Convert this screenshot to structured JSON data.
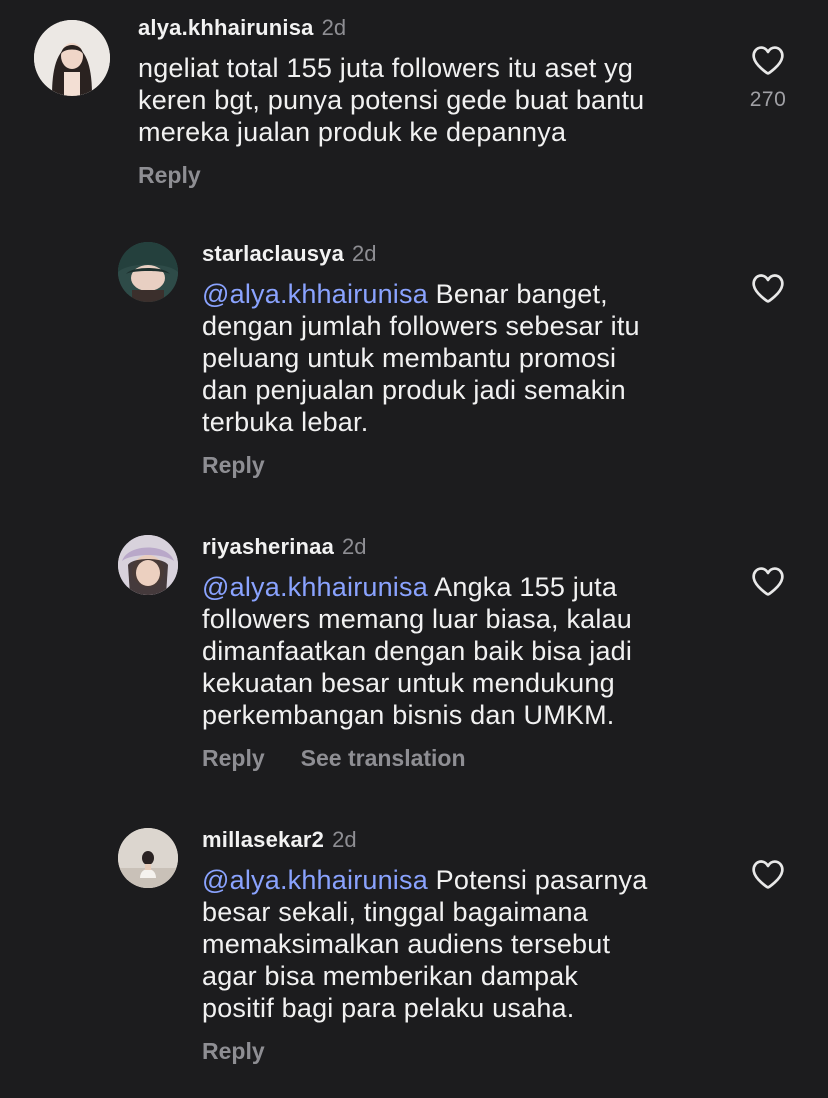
{
  "comments": [
    {
      "username": "alya.khhairunisa",
      "time": "2d",
      "lines": [
        "ngeliat total 155 juta followers itu aset yg",
        "keren bgt, punya potensi gede buat bantu",
        "mereka jualan produk ke depannya"
      ],
      "reply_label": "Reply",
      "like_count": "270",
      "like_icon": "heart-outline-icon"
    },
    {
      "username": "starlaclausya",
      "time": "2d",
      "mention": "@alya.khhairunisa",
      "first_line_rest": " Benar banget,",
      "lines": [
        "dengan jumlah followers sebesar itu",
        "peluang untuk membantu promosi",
        "dan penjualan produk jadi semakin",
        "terbuka lebar."
      ],
      "reply_label": "Reply",
      "like_icon": "heart-outline-icon"
    },
    {
      "username": "riyasherinaa",
      "time": "2d",
      "mention": "@alya.khhairunisa",
      "first_line_rest": " Angka 155 juta",
      "lines": [
        "followers memang luar biasa, kalau",
        "dimanfaatkan dengan baik bisa jadi",
        "kekuatan besar untuk mendukung",
        "perkembangan bisnis dan UMKM."
      ],
      "reply_label": "Reply",
      "translation_label": "See translation",
      "like_icon": "heart-outline-icon"
    },
    {
      "username": "millasekar2",
      "time": "2d",
      "mention": "@alya.khhairunisa",
      "first_line_rest": " Potensi pasarnya",
      "lines": [
        "besar sekali, tinggal bagaimana",
        "memaksimalkan audiens tersebut",
        "agar bisa memberikan dampak",
        "positif bagi para pelaku usaha."
      ],
      "reply_label": "Reply",
      "like_icon": "heart-outline-icon"
    }
  ],
  "colors": {
    "background": "#1c1c1e",
    "mention": "#8aa3ff",
    "muted": "#8e8e93"
  }
}
